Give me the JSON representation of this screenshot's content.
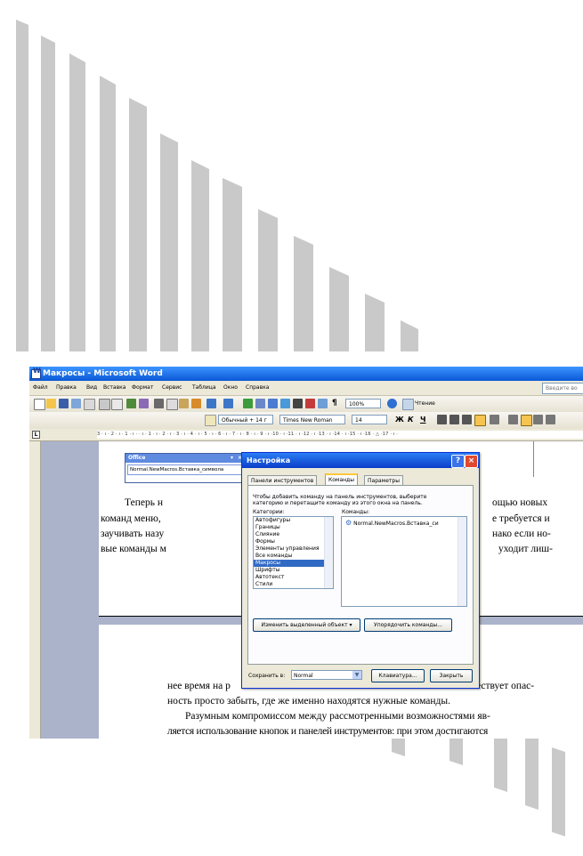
{
  "watermark": {
    "color": "#c9c9c9"
  },
  "window": {
    "title": "Макросы - Microsoft Word",
    "menu": [
      "Файл",
      "Правка",
      "Вид",
      "Вставка",
      "Формат",
      "Сервис",
      "Таблица",
      "Окно",
      "Справка"
    ],
    "help_placeholder": "Введите во",
    "zoom": "100%",
    "reading_label": "Чтение",
    "style": "Обычный + 14 г",
    "font": "Times New Roman",
    "font_size": "14",
    "bold": "Ж",
    "italic": "К",
    "underline": "Ч",
    "ruler_numbers": "3 · ı · 2 · ı · 1 · ı ·   · ı · 1 · ı · 2 · ı · 3 · ı · 4 · ı · 5 · ı · 6 · ı · 7 · ı · 8 · ı · 9 · ı ·10 · ı ·11 · ı ·12 · ı ·13 · ı ·14 · ı ·15 · ı ·16 · △ ·17 · ı ·"
  },
  "document": {
    "page1_lines": [
      "Теперь н",
      "команд меню,",
      "заучивать назу",
      "вые команды м"
    ],
    "page1_right": [
      "ощью новых",
      "е требуется и",
      "нако если но-",
      "уходит лиш-"
    ],
    "page2_lines": [
      "нее время на р",
      "ность просто забыть, где же именно находятся нужные команды.",
      "Разумным компромиссом между рассмотренными возможностями яв-",
      "ляется использование кнопок и панелей инструментов: при этом достигаются"
    ],
    "page2_right": "ествует опас-"
  },
  "office_pane": {
    "title": "Office",
    "item": "Normal.NewMacros.Вставка_символа"
  },
  "dialog": {
    "title": "Настройка",
    "tabs": [
      "Панели инструментов",
      "Команды",
      "Параметры"
    ],
    "hint_line1": "Чтобы добавить команду на панель инструментов, выберите",
    "hint_line2": "категорию и перетащите команду из этого окна на панель.",
    "categories_label": "Категории:",
    "commands_label": "Команды:",
    "categories": [
      "Автофигуры",
      "Границы",
      "Слияние",
      "Формы",
      "Элементы управления",
      "Все команды",
      "Макросы",
      "Шрифты",
      "Автотекст",
      "Стили"
    ],
    "selected_category": "Макросы",
    "command_item": "Normal.NewMacros.Вставка_си",
    "modify_button": "Изменить выделенный объект",
    "rearrange_button": "Упорядочить команды...",
    "save_in_label": "Сохранить в:",
    "save_in_value": "Normal",
    "keyboard_button": "Клавиатура...",
    "close_button": "Закрыть"
  }
}
